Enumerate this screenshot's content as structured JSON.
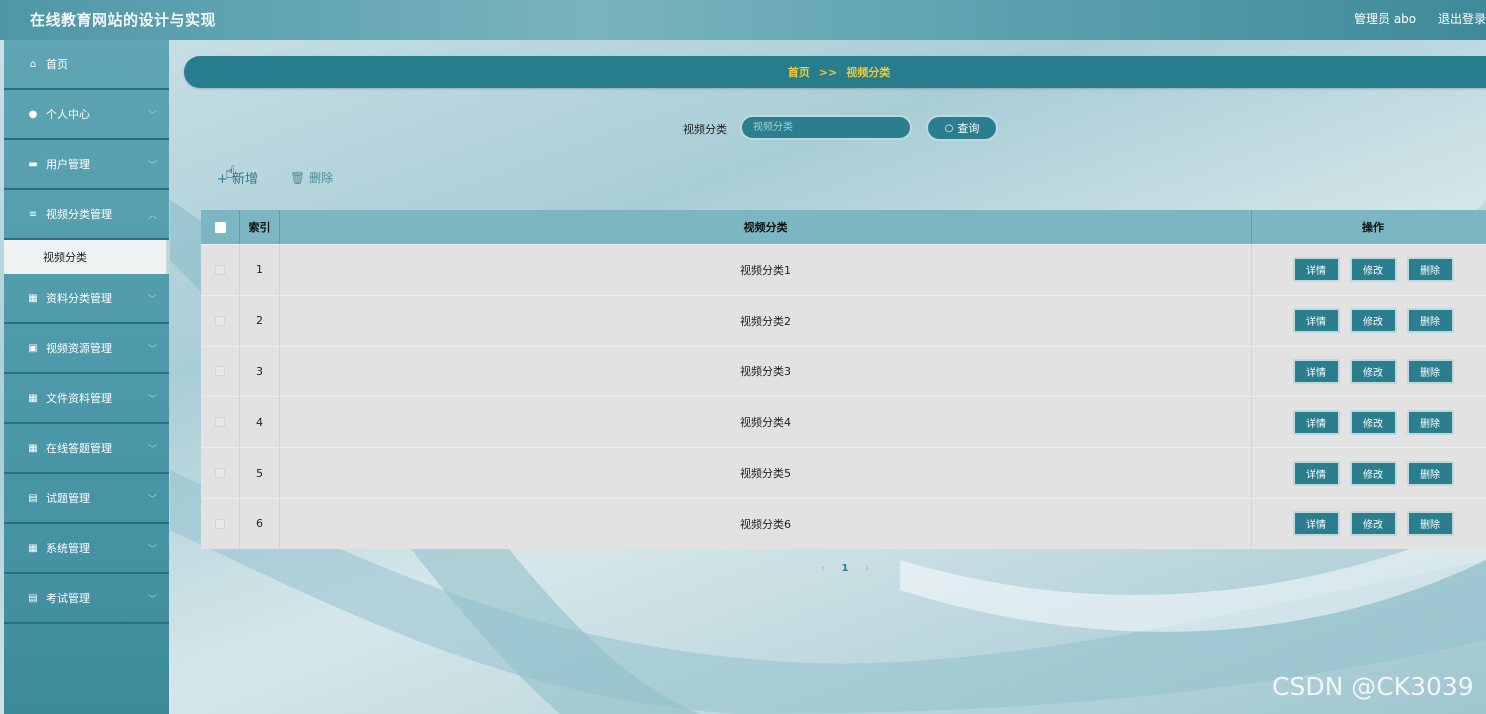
{
  "app": {
    "title": "在线教育网站的设计与实现",
    "user": "管理员 abo",
    "logout": "退出登录"
  },
  "sidebar": {
    "items": [
      {
        "label": "首页",
        "icon": "home-icon",
        "glyph": "⌂"
      },
      {
        "label": "个人中心",
        "icon": "user-icon",
        "glyph": "●"
      },
      {
        "label": "用户管理",
        "icon": "monitor-icon",
        "glyph": "▬"
      },
      {
        "label": "视频分类管理",
        "icon": "sliders-icon",
        "glyph": "≡"
      },
      {
        "label": "资料分类管理",
        "icon": "grid-icon",
        "glyph": "▦"
      },
      {
        "label": "视频资源管理",
        "icon": "image-icon",
        "glyph": "▣"
      },
      {
        "label": "文件资料管理",
        "icon": "grid-icon",
        "glyph": "▦"
      },
      {
        "label": "在线答题管理",
        "icon": "table-icon",
        "glyph": "▦"
      },
      {
        "label": "试题管理",
        "icon": "clipboard-icon",
        "glyph": "▤"
      },
      {
        "label": "系统管理",
        "icon": "grid-icon",
        "glyph": "▦"
      },
      {
        "label": "考试管理",
        "icon": "clipboard-icon",
        "glyph": "▤"
      }
    ],
    "active_sub": "视频分类"
  },
  "breadcrumb": {
    "home": "首页",
    "sep": ">>",
    "current": "视频分类"
  },
  "search": {
    "label": "视频分类",
    "placeholder": "视频分类",
    "button": "查询"
  },
  "actions": {
    "add": "+ 新增",
    "delete": "删除"
  },
  "table": {
    "headers": {
      "index": "索引",
      "name": "视频分类",
      "ops": "操作"
    },
    "rows": [
      {
        "index": "1",
        "name": "视频分类1"
      },
      {
        "index": "2",
        "name": "视频分类2"
      },
      {
        "index": "3",
        "name": "视频分类3"
      },
      {
        "index": "4",
        "name": "视频分类4"
      },
      {
        "index": "5",
        "name": "视频分类5"
      },
      {
        "index": "6",
        "name": "视频分类6"
      }
    ],
    "op_labels": {
      "detail": "详情",
      "edit": "修改",
      "delete": "删除"
    }
  },
  "pager": {
    "prev": "‹",
    "page": "1",
    "next": "›"
  },
  "watermark": "CSDN @CK3039",
  "colors": {
    "primary": "#2a7e8d",
    "breadcrumb_text": "#f0c93c",
    "header": "#7bb6c2"
  }
}
